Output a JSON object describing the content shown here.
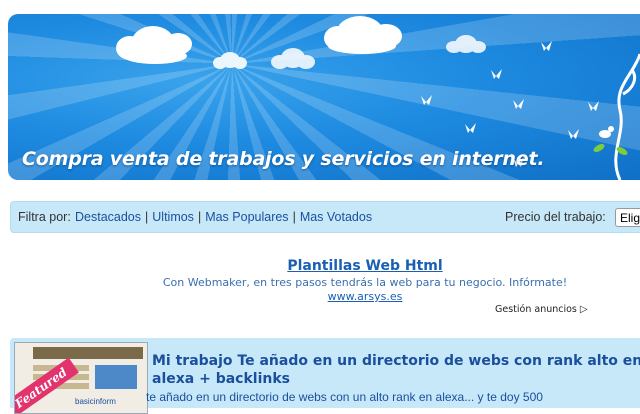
{
  "banner": {
    "tagline": "Compra venta de trabajos y servicios en internet."
  },
  "filter": {
    "label": "Filtra por:",
    "links": [
      "Destacados",
      "Ultimos",
      "Mas Populares",
      "Mas Votados"
    ],
    "price_label": "Precio del trabajo:",
    "price_select_value": "Elig"
  },
  "ad": {
    "title": "Plantillas Web Html",
    "description": "Con Webmaker, en tres pasos tendrás la web para tu negocio. Infórmate!",
    "url": "www.arsys.es",
    "manage_label": "Gestión anuncios"
  },
  "listing": {
    "badge": "Featured",
    "thumb_brand": "basicinform",
    "title": "Mi trabajo Te añado en un directorio de webs con rank alto en alexa + backlinks",
    "description": "te añado en un directorio de webs con un alto rank en alexa... y te doy 500"
  },
  "colors": {
    "banner_blue": "#1d8ae0",
    "filter_bg": "#c7e8f8",
    "link_blue": "#1a4f9e",
    "badge_pink": "#e2336f"
  }
}
